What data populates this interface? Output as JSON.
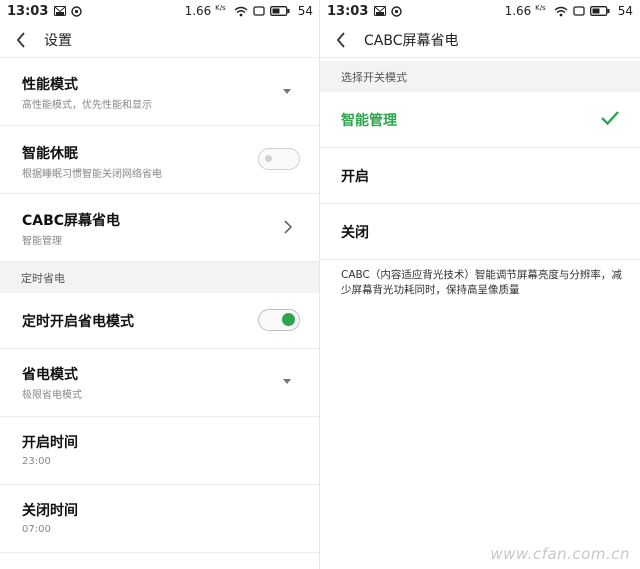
{
  "status_left": {
    "time": "13:03",
    "speed": "1.66",
    "speed_unit": "K/s",
    "battery": "54"
  },
  "status_right": {
    "time": "13:03",
    "speed": "1.66",
    "speed_unit": "K/s",
    "battery": "54"
  },
  "left": {
    "title": "设置",
    "rows": [
      {
        "label": "性能模式",
        "sub": "高性能模式，优先性能和显示"
      },
      {
        "label": "智能休眠",
        "sub": "根据睡眠习惯智能关闭网络省电",
        "toggle": "off"
      },
      {
        "label": "CABC屏幕省电",
        "sub": "智能管理"
      }
    ],
    "section": "定时省电",
    "rows2": [
      {
        "label": "定时开启省电模式",
        "toggle": "on"
      },
      {
        "label": "省电模式",
        "sub": "极限省电模式"
      },
      {
        "label": "开启时间",
        "sub": "23:00"
      },
      {
        "label": "关闭时间",
        "sub": "07:00"
      }
    ]
  },
  "right": {
    "title": "CABC屏幕省电",
    "section": "选择开关模式",
    "options": [
      {
        "label": "智能管理",
        "selected": true
      },
      {
        "label": "开启",
        "selected": false
      },
      {
        "label": "关闭",
        "selected": false
      }
    ],
    "description": "CABC（内容适应背光技术）智能调节屏幕亮度与分辨率，减少屏幕背光功耗同时，保持高呈像质量"
  },
  "watermark": "www.cfan.com.cn",
  "colors": {
    "accent": "#2ea44f",
    "section_bg": "#f3f3f3",
    "divider": "#ececec"
  },
  "icons": [
    "mail-icon",
    "sync-icon",
    "wifi-icon",
    "rotate-icon",
    "battery-icon",
    "back-arrow-icon",
    "dropdown-caret-icon",
    "chevron-right-icon",
    "checkmark-icon"
  ]
}
